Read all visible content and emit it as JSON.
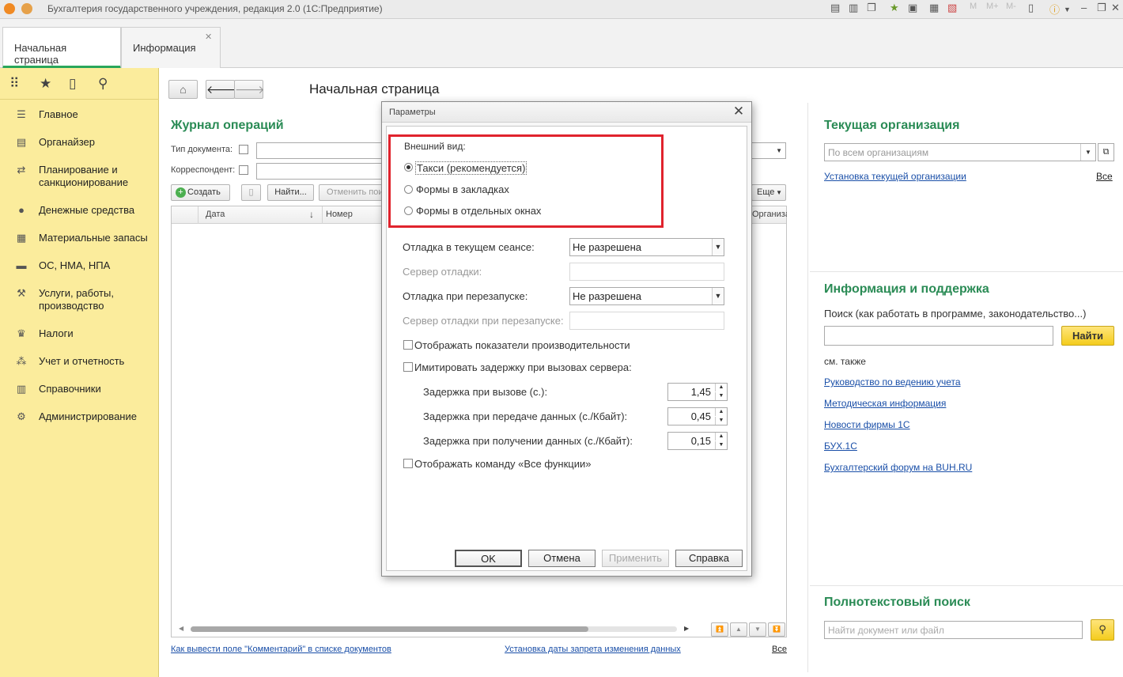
{
  "window": {
    "title": "Бухгалтерия государственного учреждения, редакция 2.0  (1С:Предприятие)"
  },
  "tabs": [
    {
      "label": "Начальная страница"
    },
    {
      "label": "Информация"
    }
  ],
  "sidebar": {
    "items": [
      {
        "label": "Главное",
        "icon": "☰"
      },
      {
        "label": "Органайзер",
        "icon": "▤"
      },
      {
        "label": "Планирование и санкционирование",
        "icon": "⇄"
      },
      {
        "label": "Денежные средства",
        "icon": "●"
      },
      {
        "label": "Материальные запасы",
        "icon": "▦"
      },
      {
        "label": "ОС, НМА, НПА",
        "icon": "▬"
      },
      {
        "label": "Услуги, работы, производство",
        "icon": "⚒"
      },
      {
        "label": "Налоги",
        "icon": "♛"
      },
      {
        "label": "Учет и отчетность",
        "icon": "⁂"
      },
      {
        "label": "Справочники",
        "icon": "▥"
      },
      {
        "label": "Администрирование",
        "icon": "⚙"
      }
    ]
  },
  "page": {
    "title": "Начальная страница"
  },
  "journal": {
    "title": "Журнал операций",
    "doc_type_label": "Тип документа:",
    "correspondent_label": "Корреспондент:",
    "create_btn": "Создать",
    "find_btn": "Найти...",
    "cancel_search_btn": "Отменить пои",
    "more_btn": "Еще",
    "columns": [
      "Дата",
      "Номер",
      "Организа"
    ],
    "link_comment": "Как вывести поле \"Комментарий\" в списке документов",
    "link_lock_date": "Установка даты запрета изменения данных",
    "link_all": "Все"
  },
  "current_org": {
    "title": "Текущая организация",
    "placeholder": "По всем организациям",
    "link_setup": "Установка текущей организации",
    "link_all": "Все"
  },
  "support": {
    "title": "Информация и поддержка",
    "search_label": "Поиск (как работать в программе, законодательство...)",
    "find_btn": "Найти",
    "see_also": "см. также",
    "links": [
      "Руководство по ведению учета",
      "Методическая информация",
      "Новости фирмы 1С",
      "БУХ.1С",
      "Бухгалтерский форум на BUH.RU"
    ]
  },
  "fulltext": {
    "title": "Полнотекстовый поиск",
    "placeholder": "Найти документ или файл"
  },
  "dialog": {
    "title": "Параметры",
    "appearance_label": "Внешний вид:",
    "radio_options": [
      {
        "label": "Такси (рекомендуется)",
        "selected": true
      },
      {
        "label": "Формы в закладках",
        "selected": false
      },
      {
        "label": "Формы в отдельных окнах",
        "selected": false
      }
    ],
    "debug_session_label": "Отладка в текущем сеансе:",
    "debug_session_value": "Не разрешена",
    "debug_server_label": "Сервер отладки:",
    "debug_restart_label": "Отладка при перезапуске:",
    "debug_restart_value": "Не разрешена",
    "debug_restart_server_label": "Сервер отладки при перезапуске:",
    "perf_label": "Отображать показатели производительности",
    "delay_label": "Имитировать задержку при вызовах сервера:",
    "delay_call_label": "Задержка при вызове (с.):",
    "delay_call_value": "1,45",
    "delay_send_label": "Задержка при передаче данных (с./Кбайт):",
    "delay_send_value": "0,45",
    "delay_recv_label": "Задержка при получении данных (с./Кбайт):",
    "delay_recv_value": "0,15",
    "all_functions_label": "Отображать команду «Все функции»",
    "ok_btn": "OK",
    "cancel_btn": "Отмена",
    "apply_btn": "Применить",
    "help_btn": "Справка"
  },
  "colors": {
    "accent_green": "#2a8b55",
    "sidebar_bg": "#fbec9c",
    "highlight_red": "#e0232d",
    "link_blue": "#1a4fa8"
  }
}
